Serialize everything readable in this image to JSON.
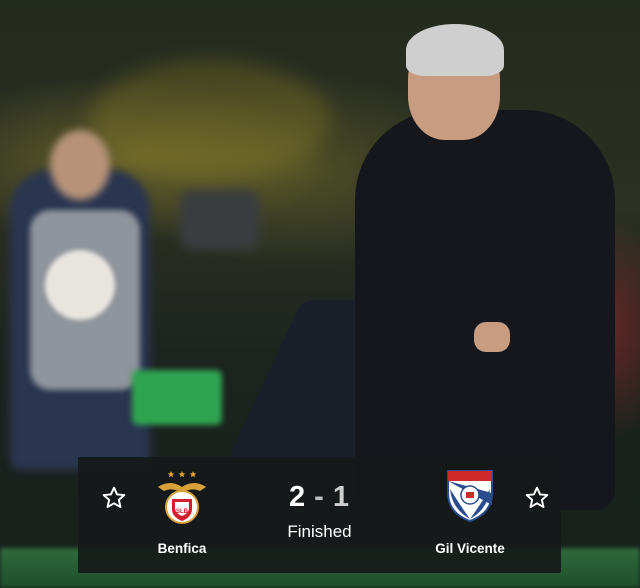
{
  "match": {
    "home_team": "Benfica",
    "away_team": "Gil Vicente",
    "home_score": "2",
    "separator": "-",
    "away_score": "1",
    "status": "Finished"
  },
  "icons": {
    "favorite_left": "star-outline-icon",
    "favorite_right": "star-outline-icon",
    "home_crest": "benfica-crest-icon",
    "away_crest": "gil-vicente-crest-icon"
  },
  "colors": {
    "card_background": "#161919",
    "text_primary": "#ffffff",
    "benfica_red": "#d11f2f",
    "gil_blue": "#2a4c8f",
    "gil_red": "#d12a2a"
  }
}
